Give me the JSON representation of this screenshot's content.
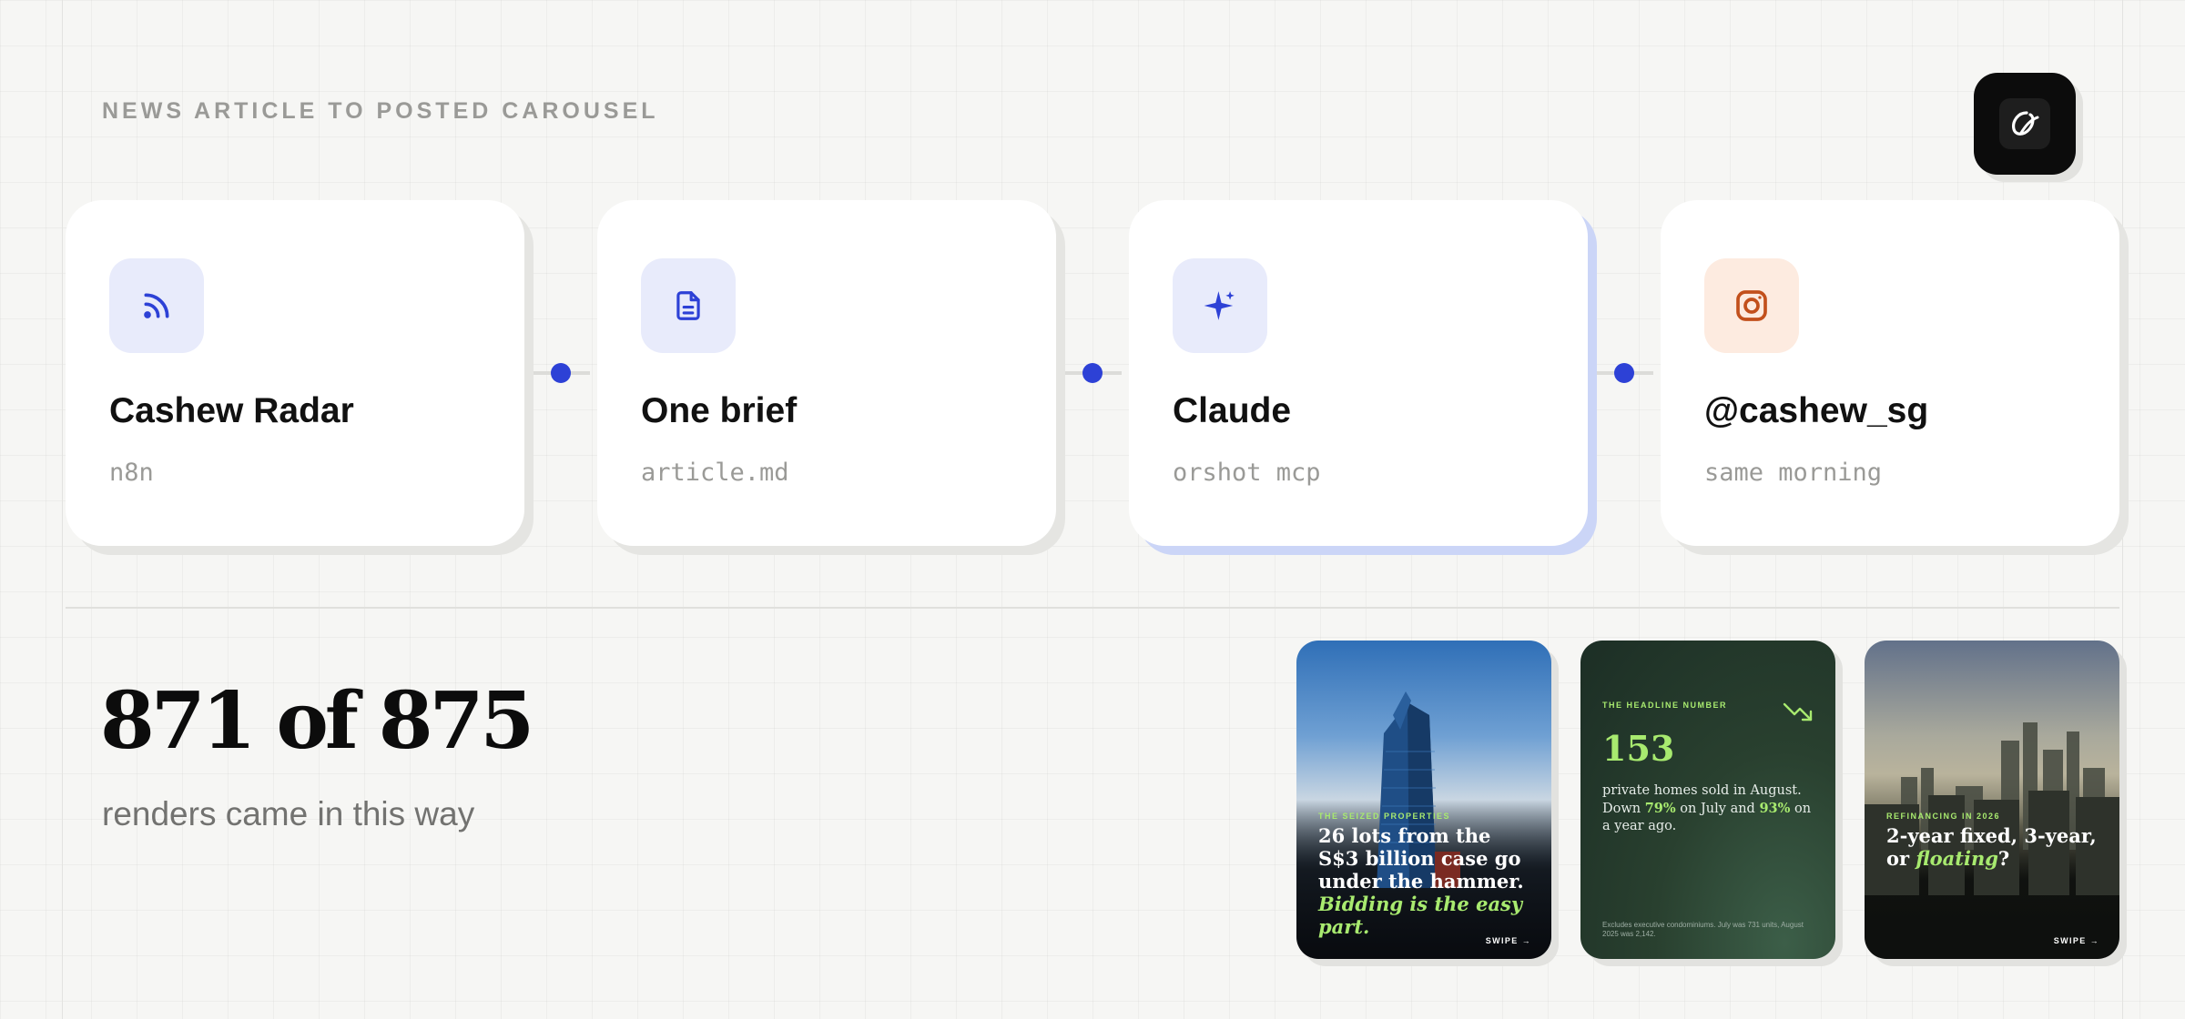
{
  "header": {
    "eyebrow": "NEWS ARTICLE TO POSTED CAROUSEL",
    "logo_icon": "orshot-logo-icon"
  },
  "pipeline": [
    {
      "title": "Cashew Radar",
      "subtitle": "n8n",
      "icon": "rss-icon"
    },
    {
      "title": "One brief",
      "subtitle": "article.md",
      "icon": "document-icon"
    },
    {
      "title": "Claude",
      "subtitle": "orshot mcp",
      "icon": "sparkle-icon",
      "active": true
    },
    {
      "title": "@cashew_sg",
      "subtitle": "same morning",
      "icon": "instagram-icon"
    }
  ],
  "stats": {
    "headline": "871 of 875",
    "caption": "renders came in this way"
  },
  "slides": [
    {
      "kicker": "THE SEIZED PROPERTIES",
      "headline_plain": "26 lots from the S$3 billion case go under the hammer. ",
      "headline_highlight": "Bidding is the easy part.",
      "swipe": "SWIPE →"
    },
    {
      "kicker": "THE HEADLINE NUMBER",
      "number": "153",
      "body_1": "private homes sold in August. Down ",
      "pct_1": "79%",
      "body_2": " on July and ",
      "pct_2": "93%",
      "body_3": " on a year ago.",
      "footnote": "Excludes executive condominiums. July was 731 units, August 2025 was 2,142.",
      "icon": "trending-down-icon"
    },
    {
      "kicker": "REFINANCING IN 2026",
      "headline_plain": "2-year fixed, 3-year, or ",
      "headline_highlight": "floating",
      "headline_end": "?",
      "swipe": "SWIPE →"
    }
  ],
  "colors": {
    "accent": "#2d41d6",
    "highlight_green": "#a8ea6f",
    "instagram": "#c2501c"
  }
}
